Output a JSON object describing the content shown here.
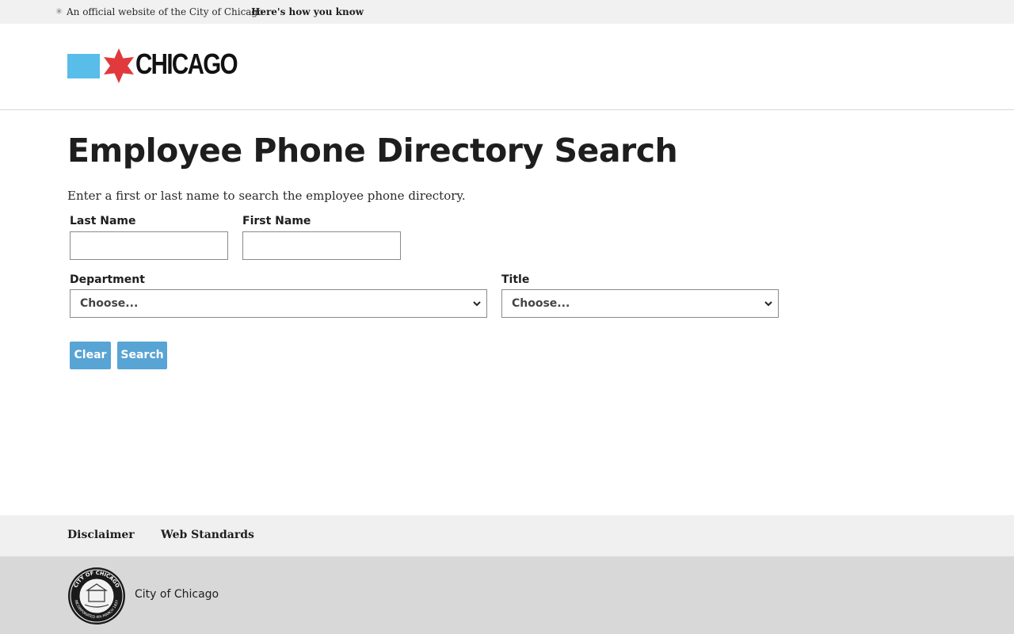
{
  "banner": {
    "official_text": "An official website of the City of Chicago",
    "how_know_label": "Here's how you know"
  },
  "header": {
    "logo_text": "CHICAGO",
    "colors": {
      "flag_blue": "#58bde9",
      "flag_red": "#e03a3e"
    }
  },
  "main": {
    "title": "Employee Phone Directory Search",
    "intro": "Enter a first or last name to search the employee phone directory.",
    "form": {
      "last_name_label": "Last Name",
      "last_name_value": "",
      "first_name_label": "First Name",
      "first_name_value": "",
      "department_label": "Department",
      "department_selected": "Choose...",
      "title_label": "Title",
      "title_selected": "Choose...",
      "clear_label": "Clear",
      "search_label": "Search"
    },
    "colors": {
      "button": "#58a4d4"
    }
  },
  "footer": {
    "links": [
      "Disclaimer",
      "Web Standards"
    ],
    "seal_text_top": "CITY OF CHICAGO",
    "seal_text_bottom": "INCORPORATED 4th MARCH 1837",
    "city_name": "City of Chicago"
  }
}
